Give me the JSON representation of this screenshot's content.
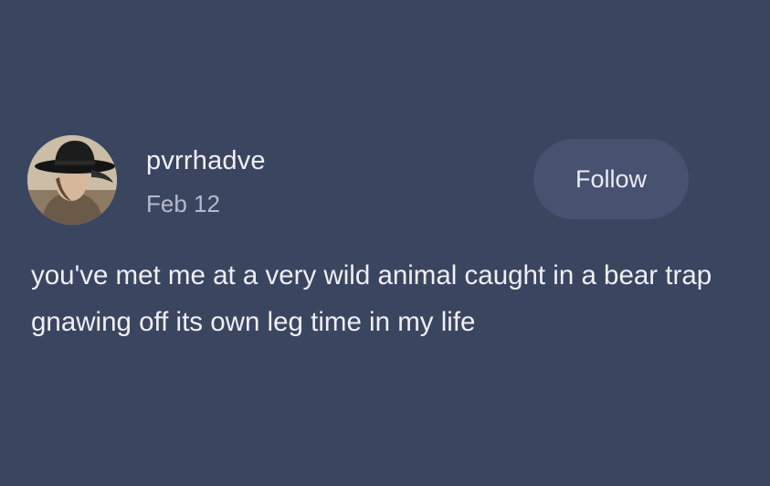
{
  "post": {
    "author": {
      "username": "pvrrhadve",
      "avatar_icon": "profile-photo-cowboy-hat"
    },
    "date": "Feb 12",
    "follow_label": "Follow",
    "text": "you've met me at a very wild animal caught in a bear trap gnawing off its own leg time in my life"
  },
  "colors": {
    "background": "#3a4560",
    "button_background": "#475270",
    "primary_text": "#eef0f5",
    "secondary_text": "#b4bacb"
  }
}
